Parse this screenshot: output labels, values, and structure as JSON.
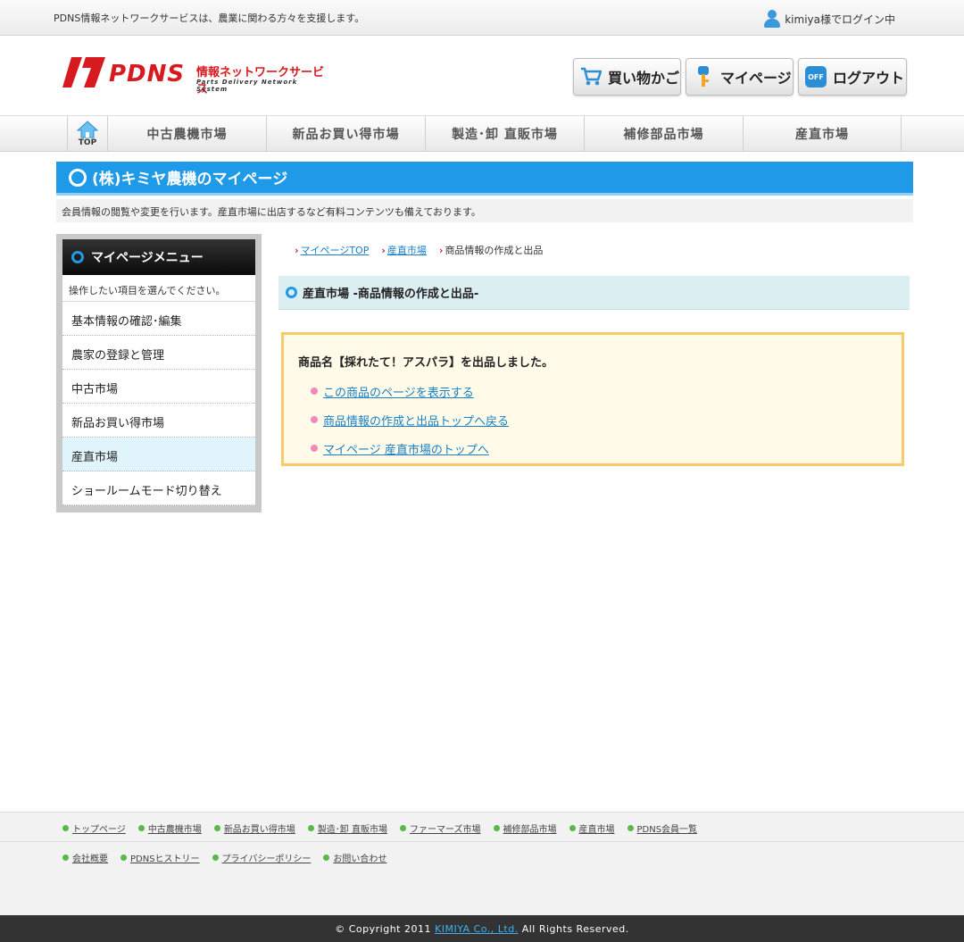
{
  "topbar": {
    "tagline": "PDNS情報ネットワークサービスは、農業に関わる方々を支援します。",
    "login_status": "kimiya様でログイン中"
  },
  "header": {
    "logo_brand": "PDNS",
    "logo_sub": "情報ネットワークサービス",
    "logo_sub2": "Parts Delivery Network System",
    "cart_label": "買い物かご",
    "mypage_label": "マイページ",
    "logout_label": "ログアウト",
    "logout_badge": "OFF"
  },
  "gnav": {
    "top_label": "TOP",
    "items": [
      "中古農機市場",
      "新品お買い得市場",
      "製造･卸 直販市場",
      "補修部品市場",
      "産直市場"
    ]
  },
  "page": {
    "title": "(株)キミヤ農機のマイページ",
    "description": "会員情報の閲覧や変更を行います。産直市場に出店するなど有料コンテンツも備えております。"
  },
  "side": {
    "heading": "マイページメニュー",
    "note": "操作したい項目を選んでください。",
    "items": [
      "基本情報の確認･編集",
      "農家の登録と管理",
      "中古市場",
      "新品お買い得市場",
      "産直市場",
      "ショールームモード切り替え"
    ],
    "active_index": 4
  },
  "breadcrumb": {
    "items": [
      "マイページTOP",
      "産直市場"
    ],
    "current": "商品情報の作成と出品"
  },
  "section": {
    "title": "産直市場 -商品情報の作成と出品-"
  },
  "notice": {
    "message": "商品名【採れたて！アスパラ】を出品しました。",
    "links": [
      "この商品のページを表示する",
      "商品情報の作成と出品トップへ戻る",
      "マイページ 産直市場のトップへ"
    ]
  },
  "footer": {
    "row1": [
      "トップページ",
      "中古農機市場",
      "新品お買い得市場",
      "製造･卸 直販市場",
      "ファーマーズ市場",
      "補修部品市場",
      "産直市場",
      "PDNS会員一覧"
    ],
    "row2": [
      "会社概要",
      "PDNSヒストリー",
      "プライバシーポリシー",
      "お問い合わせ"
    ],
    "copyright_pre": "© Copyright 2011",
    "copyright_company": "KIMIYA Co., Ltd.",
    "copyright_post": "All Rights Reserved."
  },
  "colors": {
    "accent_blue": "#1e9ae8",
    "brand_red": "#d71920",
    "notice_border": "#f8ca6b"
  }
}
